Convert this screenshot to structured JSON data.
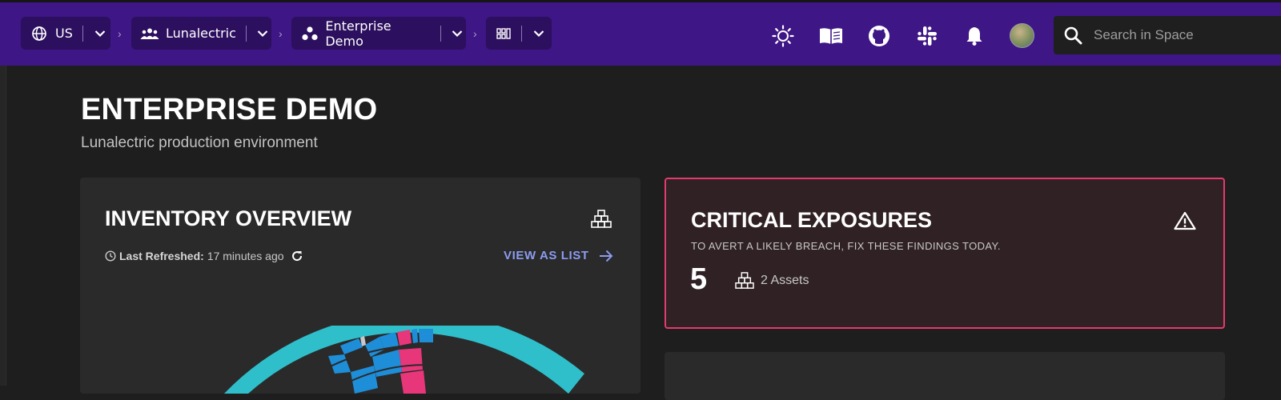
{
  "breadcrumbs": [
    {
      "label": "US",
      "icon": "globe-icon"
    },
    {
      "label": "Lunalectric",
      "icon": "people-icon"
    },
    {
      "label": "Enterprise Demo",
      "icon": "space-icon"
    },
    {
      "label": "",
      "icon": "grid-icon"
    }
  ],
  "toolbar": {
    "icons": [
      "theme-icon",
      "docs-icon",
      "github-icon",
      "slack-icon",
      "bell-icon"
    ],
    "search_placeholder": "Search in Space"
  },
  "page": {
    "title": "ENTERPRISE DEMO",
    "subtitle": "Lunalectric production environment"
  },
  "inventory": {
    "title": "INVENTORY OVERVIEW",
    "refreshed_label": "Last Refreshed:",
    "refreshed_value": "17 minutes ago",
    "view_list": "VIEW AS LIST"
  },
  "critical": {
    "title": "CRITICAL EXPOSURES",
    "subtitle": "TO AVERT A LIKELY BREACH, FIX THESE FINDINGS TODAY.",
    "count": "5",
    "assets": "2 Assets"
  },
  "colors": {
    "topbar": "#3e1685",
    "crumb": "#2c0f5e",
    "accent_link": "#8c9cf0",
    "critical_border": "#e43a6d",
    "teal": "#2fbfcb",
    "blue": "#1e8ed8",
    "pink": "#e8367a"
  }
}
